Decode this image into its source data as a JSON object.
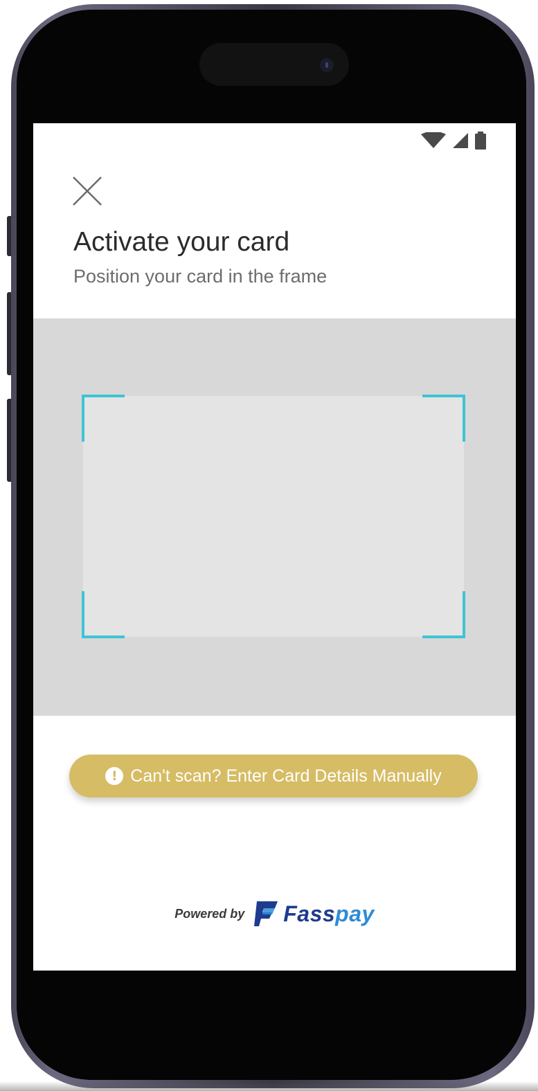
{
  "device": {
    "frame_color": "#4a4658",
    "screen_bg": "#ffffff"
  },
  "status_bar": {
    "icons": [
      "wifi-icon",
      "cellular-signal-icon",
      "battery-icon"
    ]
  },
  "header": {
    "close_icon": "close-icon",
    "title": "Activate your card",
    "subtitle": "Position your card in the frame"
  },
  "scanner": {
    "area_color": "#d8d8d8",
    "frame_color": "#e4e4e4",
    "corner_color": "#3ec4d4"
  },
  "manual_entry": {
    "icon": "exclamation-icon",
    "icon_glyph": "!",
    "label": "Can't scan? Enter Card Details Manually",
    "color": "#d6bc64"
  },
  "footer": {
    "powered_by": "Powered by",
    "brand_part1": "Fass",
    "brand_part2": "pay",
    "brand_colors": [
      "#1f3b8f",
      "#2e8cd6"
    ]
  }
}
